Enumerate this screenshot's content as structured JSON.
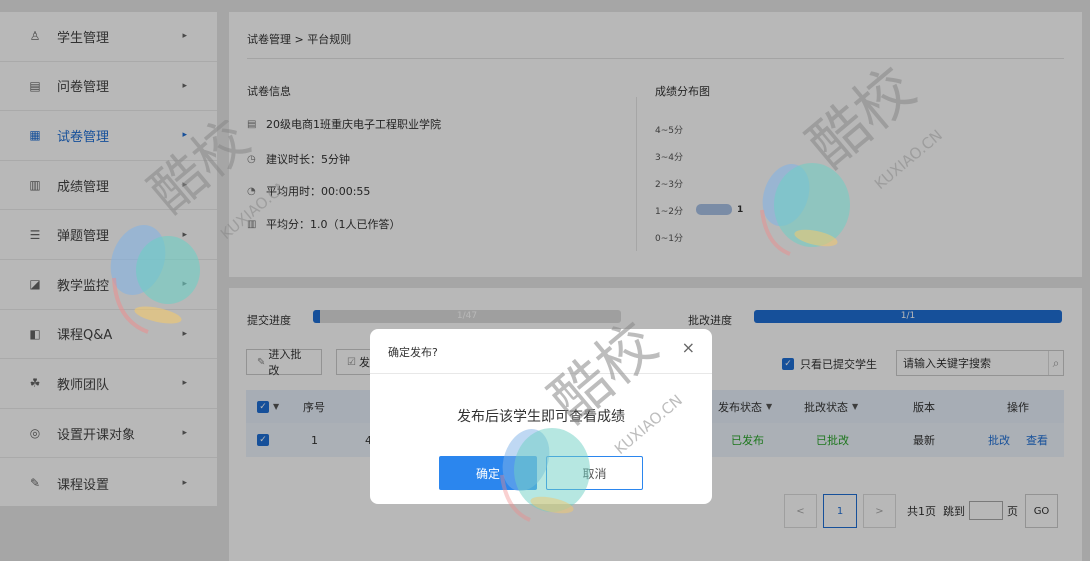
{
  "sidebar": {
    "items": [
      {
        "label": "学生管理",
        "icon": "student-icon",
        "glyph": "♙",
        "active": false
      },
      {
        "label": "问卷管理",
        "icon": "survey-icon",
        "glyph": "▤",
        "active": false
      },
      {
        "label": "试卷管理",
        "icon": "exam-icon",
        "glyph": "▦",
        "active": true
      },
      {
        "label": "成绩管理",
        "icon": "grade-icon",
        "glyph": "▥",
        "active": false
      },
      {
        "label": "弹题管理",
        "icon": "popup-question-icon",
        "glyph": "☰",
        "active": false
      },
      {
        "label": "教学监控",
        "icon": "monitor-icon",
        "glyph": "◪",
        "active": false
      },
      {
        "label": "课程Q&A",
        "icon": "qa-icon",
        "glyph": "◧",
        "active": false
      },
      {
        "label": "教师团队",
        "icon": "team-icon",
        "glyph": "☘",
        "active": false
      },
      {
        "label": "设置开课对象",
        "icon": "target-icon",
        "glyph": "◎",
        "active": false
      },
      {
        "label": "课程设置",
        "icon": "settings-icon",
        "glyph": "✎",
        "active": false
      }
    ],
    "arrow": "▸"
  },
  "breadcrumb": "试卷管理 > 平台规则",
  "exam_info": {
    "title": "试卷信息",
    "class_name": "20级电商1班重庆电子工程职业学院",
    "suggested_time": "建议时长：5分钟",
    "avg_time": "平均用时：00:00:55",
    "avg_score": "平均分：1.0（1人已作答）"
  },
  "distribution": {
    "title": "成绩分布图",
    "labels": [
      "4~5分",
      "3~4分",
      "2~3分",
      "1~2分",
      "0~1分"
    ],
    "bar_count": "1"
  },
  "chart_data": {
    "type": "bar",
    "title": "成绩分布图",
    "categories": [
      "4~5分",
      "3~4分",
      "2~3分",
      "1~2分",
      "0~1分"
    ],
    "values": [
      0,
      0,
      0,
      1,
      0
    ]
  },
  "progress": {
    "submit_label": "提交进度",
    "submit_text": "1/47",
    "submit_fraction": 0.0213,
    "grade_label": "批改进度",
    "grade_text": "1/1",
    "grade_fraction": 1.0
  },
  "toolbar": {
    "enter_grading": "进入批改",
    "publish_partial": "发",
    "only_submitted": "只看已提交学生",
    "search_placeholder": "请输入关键字搜索"
  },
  "table": {
    "headers": {
      "index": "序号",
      "publish_status": "发布状态",
      "grade_status": "批改状态",
      "version": "版本",
      "actions": "操作"
    },
    "rows": [
      {
        "index": "1",
        "partial": "4",
        "publish_status": "已发布",
        "grade_status": "已批改",
        "version": "最新",
        "action_grade": "批改",
        "action_view": "查看"
      }
    ]
  },
  "pagination": {
    "prev": "<",
    "current": "1",
    "next": ">",
    "total": "共1页",
    "jump_to": "跳到",
    "page_unit": "页",
    "go": "GO"
  },
  "modal": {
    "title": "确定发布?",
    "close": "×",
    "message": "发布后该学生即可查看成绩",
    "ok": "确定",
    "cancel": "取消"
  },
  "watermark": {
    "brand": "酷校",
    "domain": "KUXIAO.CN"
  }
}
